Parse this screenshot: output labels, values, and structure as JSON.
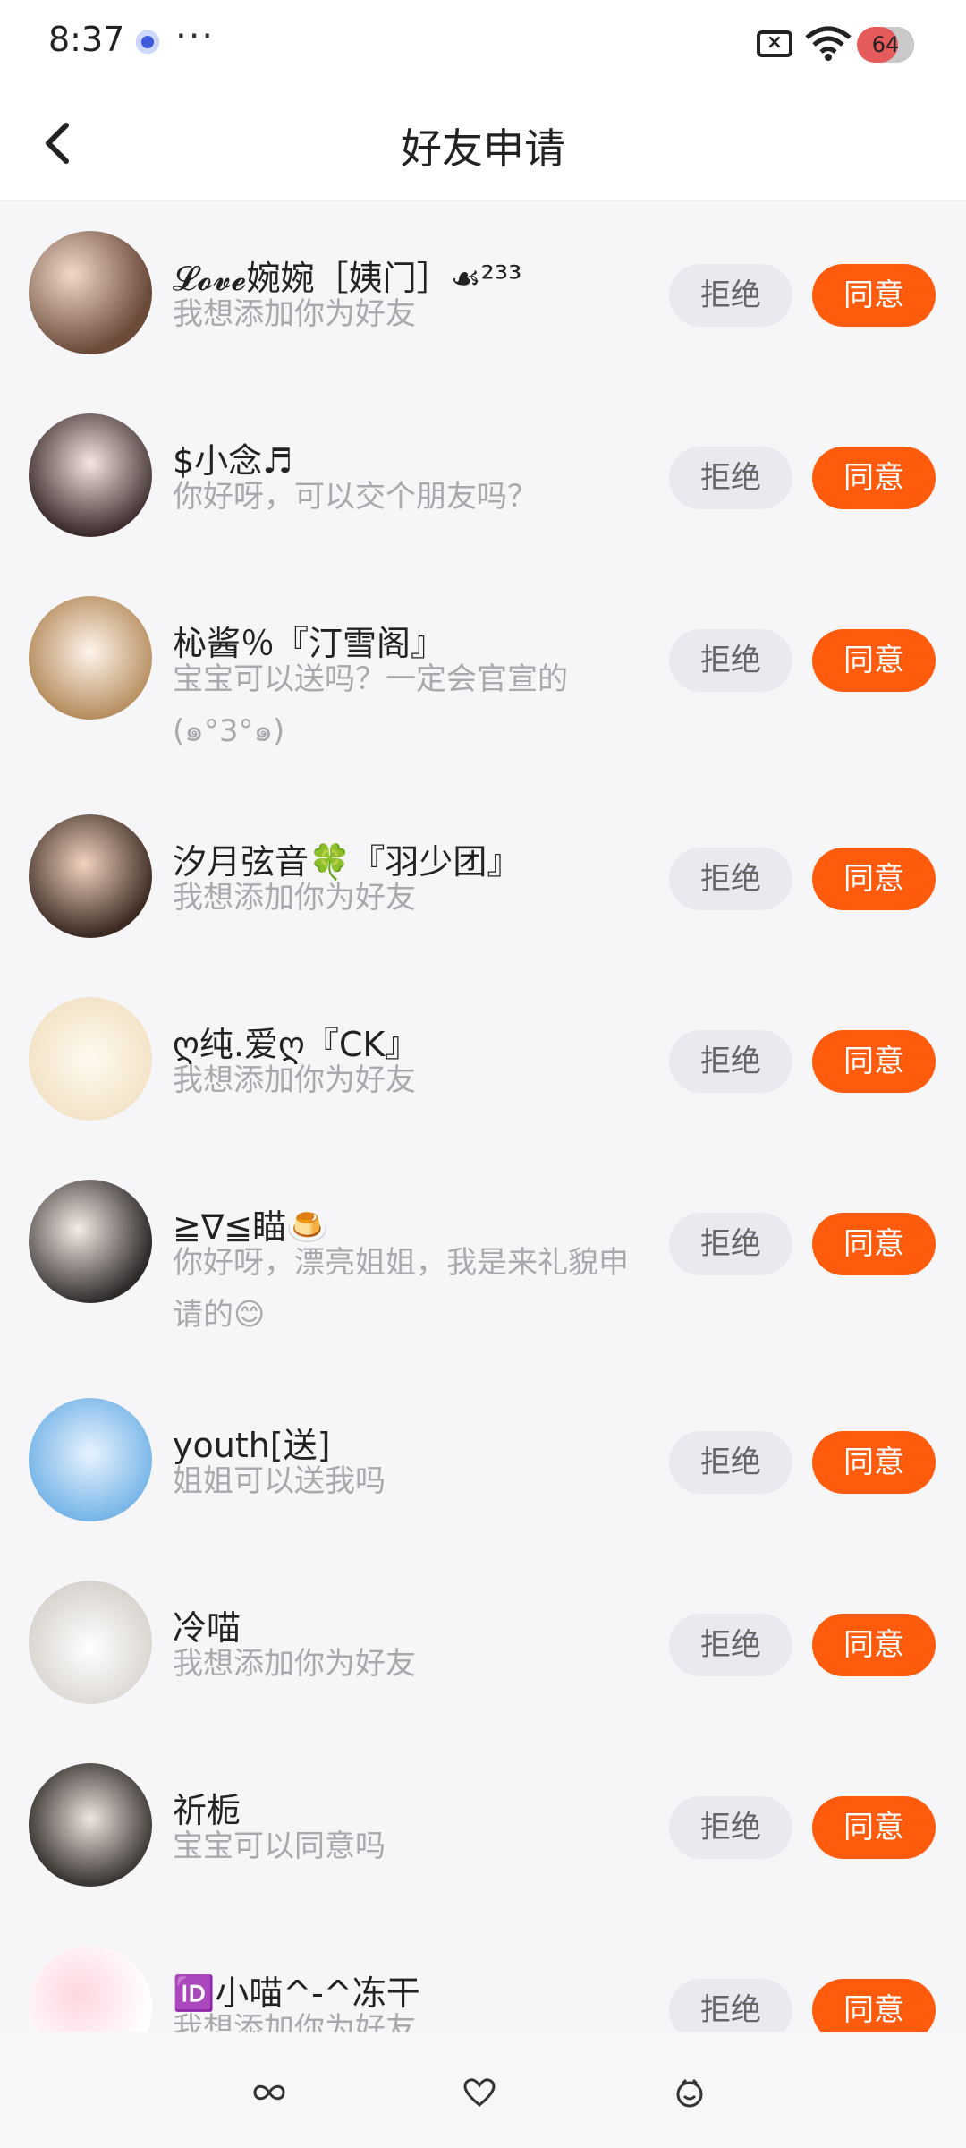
{
  "status_bar": {
    "time": "8:37",
    "dots": "···",
    "battery": "64"
  },
  "header": {
    "title": "好友申请"
  },
  "buttons": {
    "reject": "拒绝",
    "accept": "同意"
  },
  "requests": [
    {
      "name": "𝓛𝓸𝓿𝓮婉婉［姨门］☙²³³",
      "message": "我想添加你为好友"
    },
    {
      "name": "$小念♬",
      "message": "你好呀，可以交个朋友吗？"
    },
    {
      "name": "杺酱％『汀雪阁』",
      "message": "宝宝可以送吗？一定会官宣的 (๑°3°๑)"
    },
    {
      "name": "汐月弦音🍀『羽少团』",
      "message": "我想添加你为好友"
    },
    {
      "name": "ღ纯.爱ღ『CK』",
      "message": "我想添加你为好友"
    },
    {
      "name": "≧∇≦瞄🍮",
      "message": "你好呀，漂亮姐姐，我是来礼貌申请的😊"
    },
    {
      "name": "youth[送]",
      "message": "姐姐可以送我吗"
    },
    {
      "name": "冷喵",
      "message": "我想添加你为好友"
    },
    {
      "name": "祈栀",
      "message": "宝宝可以同意吗"
    },
    {
      "name": "🆔小喵^-^冻干",
      "message": "我想添加你为好友"
    }
  ],
  "colors": {
    "accent": "#ff5b0d",
    "reject_bg": "#e9eaf0",
    "subtitle": "#a9a9ad"
  },
  "bottom_nav": [
    "infinity-icon",
    "heart-icon",
    "smile-icon"
  ]
}
